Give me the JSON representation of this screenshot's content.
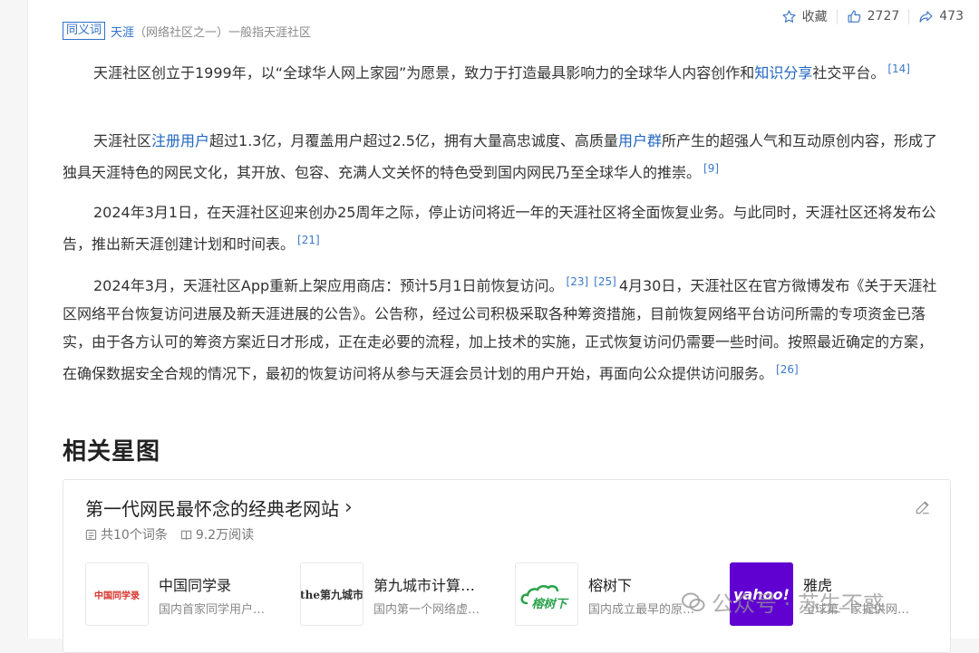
{
  "actions": {
    "favorite": "收藏",
    "likes": "2727",
    "shares": "473"
  },
  "synonym": {
    "tag": "同义词",
    "term": "天涯",
    "note": "（网络社区之一）一般指天涯社区"
  },
  "paragraphs": {
    "p1": {
      "t1": "天涯社区创立于1999年，以“全球华人网上家园”为愿景，致力于打造最具影响力的全球华人内容创作和",
      "link1": "知识分享",
      "t2": "社交平台。",
      "ref1": "[14]"
    },
    "p2": {
      "t1": "天涯社区",
      "link1": "注册用户",
      "t2": "超过1.3亿，月覆盖用户超过2.5亿，拥有大量高忠诚度、高质量",
      "link2": "用户群",
      "t3": "所产生的超强人气和互动原创内容，形成了独具天涯特色的网民文化，其开放、包容、充满人文关怀的特色受到国内网民乃至全球华人的推崇。",
      "ref1": "[9]"
    },
    "p3": {
      "t1": "2024年3月1日，在天涯社区迎来创办25周年之际，停止访问将近一年的天涯社区将全面恢复业务。与此同时，天涯社区还将发布公告，推出新天涯创建计划和时间表。",
      "ref1": "[21]"
    },
    "p4": {
      "t1": "2024年3月，天涯社区App重新上架应用商店：预计5月1日前恢复访问。",
      "ref1": "[23]",
      "ref2": "[25]",
      "t2": "4月30日，天涯社区在官方微博发布《关于天涯社区网络平台恢复访问进展及新天涯进展的公告》。公告称，经过公司积极采取各种筹资措施，目前恢复网络平台访问所需的专项资金已落实，由于各方认可的筹资方案近日才形成，正在走必要的流程，加上技术的实施，正式恢复访问仍需要一些时间。按照最近确定的方案，在确保数据安全合规的情况下，最初的恢复访问将从参与天涯会员计划的用户开始，再面向公众提供访问服务。",
      "ref3": "[26]"
    }
  },
  "section": {
    "title": "相关星图"
  },
  "card": {
    "title": "第一代网民最怀念的经典老网站",
    "entries": "共10个词条",
    "reads": "9.2万阅读",
    "items": [
      {
        "name": "中国同学录",
        "desc": "国内首家同学用户…",
        "logo_text": "中国同学录"
      },
      {
        "name": "第九城市计算…",
        "desc": "国内第一个网络虚…",
        "logo_text": "the第九城市"
      },
      {
        "name": "榕树下",
        "desc": "国内成立最早的原…",
        "logo_text": "榕树下"
      },
      {
        "name": "雅虎",
        "desc": "全球第一家提供网…",
        "logo_text": "yahoo!"
      }
    ]
  },
  "watermark": {
    "text": "公众号 · 苏生不惑"
  },
  "colors": {
    "link": "#1f66c2",
    "yahoo": "#6001d2",
    "rongshu": "#2aa24a",
    "tongxue": "#d8342c"
  }
}
